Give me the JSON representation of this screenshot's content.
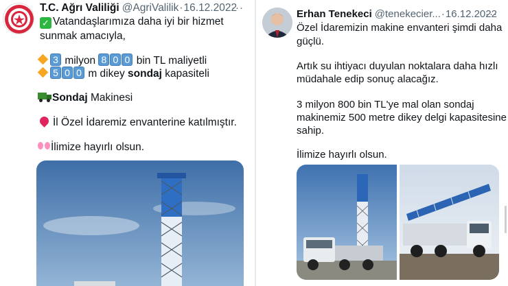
{
  "tweet_left": {
    "display_name": "T.C. Ağrı Valiliği",
    "handle": "@AgriValilik",
    "separator": "·",
    "date": "16.12.2022",
    "more": "···",
    "lines": {
      "l1": "Vatandaşlarımıza daha iyi bir hizmet",
      "l2": "sunmak amacıyla,",
      "l3_k1": "3",
      "l3_mid": "milyon",
      "l3_k2": "8",
      "l3_k3": "0",
      "l3_k4": "0",
      "l3_end": "bin TL maliyetli",
      "l4_k1": "5",
      "l4_k2": "0",
      "l4_k3": "0",
      "l4_mid": "m dikey",
      "l4_bold": "sondaj",
      "l4_end": "kapasiteli",
      "l5_bold": "Sondaj",
      "l5_end": "Makinesi",
      "l6": "İl Özel İdaremiz envanterine katılmıştır.",
      "l7": "İlimize hayırlı olsun."
    },
    "image_alt": "drilling-rig-photo"
  },
  "tweet_right": {
    "display_name": "Erhan Tenekeci",
    "handle": "@tenekecier...",
    "separator": "·",
    "date": "16.12.2022",
    "more": "···",
    "lines": {
      "l1": "Özel İdaremizin makine envanteri şimdi daha",
      "l2": "güçlü.",
      "l3": "Artık su ihtiyacı duyulan noktalara daha hızlı",
      "l4": "müdahale edip sonuç alacağız.",
      "l5": "3 milyon 800 bin TL'ye mal olan sondaj",
      "l6": "makinemiz 500 metre dikey delgi kapasitesine",
      "l7": "sahip.",
      "l8": "İlimize hayırlı olsun."
    },
    "image_alts": [
      "drilling-truck-front-photo",
      "drilling-truck-side-photo"
    ]
  },
  "colors": {
    "accent_check": "#2db742",
    "keycap": "#5b9bd5",
    "diamond": "#f6a623",
    "muted_text": "#536471"
  }
}
